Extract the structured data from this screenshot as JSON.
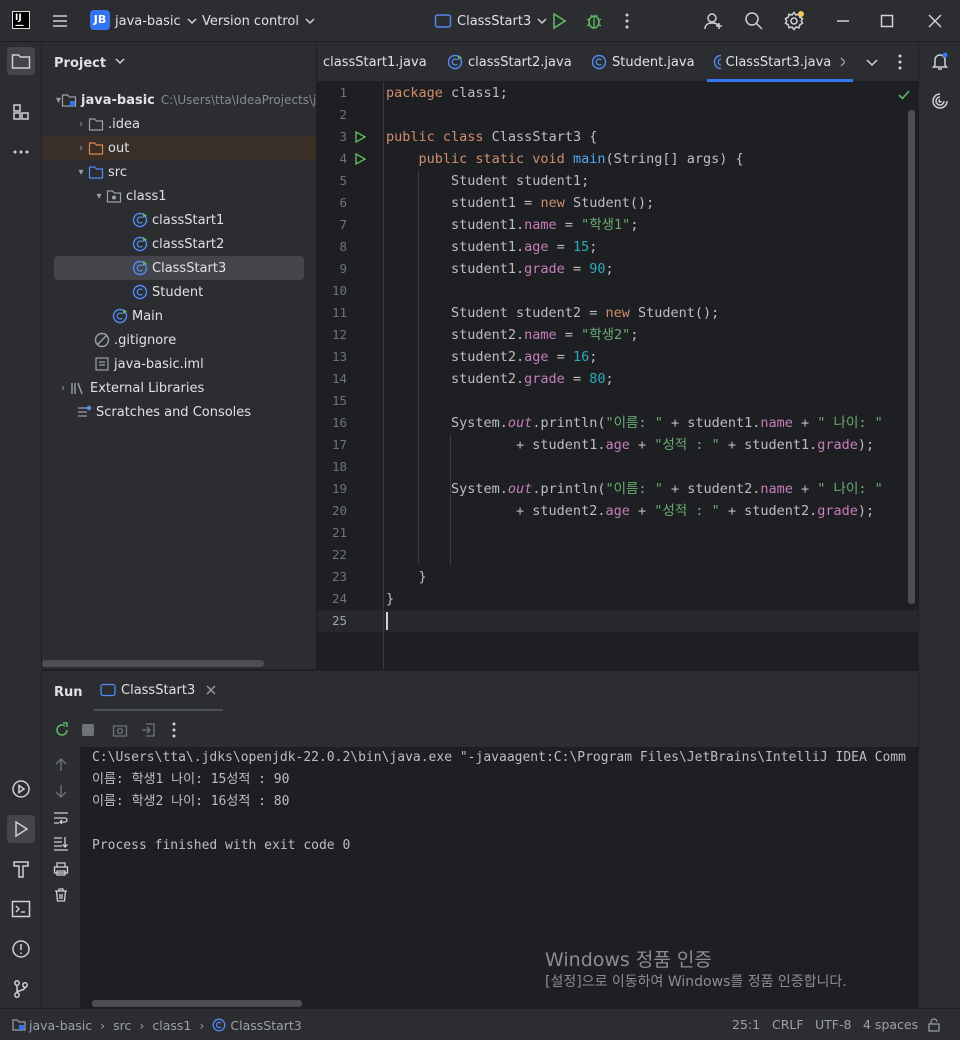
{
  "titlebar": {
    "project_badge": "JB",
    "project_name": "java-basic",
    "vcs_label": "Version control",
    "run_config": "ClassStart3"
  },
  "project_panel": {
    "title": "Project",
    "root_name": "java-basic",
    "root_path": "C:\\Users\\tta\\IdeaProjects\\ja",
    "items": [
      {
        "label": ".idea"
      },
      {
        "label": "out"
      },
      {
        "label": "src"
      },
      {
        "label": "class1"
      },
      {
        "label": "classStart1"
      },
      {
        "label": "classStart2"
      },
      {
        "label": "ClassStart3"
      },
      {
        "label": "Student"
      },
      {
        "label": "Main"
      },
      {
        "label": ".gitignore"
      },
      {
        "label": "java-basic.iml"
      },
      {
        "label": "External Libraries"
      },
      {
        "label": "Scratches and Consoles"
      }
    ]
  },
  "tabs": [
    {
      "label": "classStart1.java"
    },
    {
      "label": "classStart2.java"
    },
    {
      "label": "Student.java"
    },
    {
      "label": "ClassStart3.java"
    }
  ],
  "editor": {
    "line_numbers": [
      "1",
      "2",
      "3",
      "4",
      "5",
      "6",
      "7",
      "8",
      "9",
      "10",
      "11",
      "12",
      "13",
      "14",
      "15",
      "16",
      "17",
      "18",
      "19",
      "20",
      "21",
      "22",
      "23",
      "24",
      "25"
    ],
    "strings": {
      "s1": "\"학생1\"",
      "s2": "\"학생2\"",
      "name_lbl": "\"이름: \"",
      "age_lbl": "\" 나이: \"",
      "grade_lbl": "\"성적 : \""
    },
    "numbers": {
      "n15": "15",
      "n90": "90",
      "n16": "16",
      "n80": "80"
    }
  },
  "run_panel": {
    "title": "Run",
    "tab_label": "ClassStart3",
    "console_lines": [
      "C:\\Users\\tta\\.jdks\\openjdk-22.0.2\\bin\\java.exe \"-javaagent:C:\\Program Files\\JetBrains\\IntelliJ IDEA Comm",
      "이름: 학생1 나이: 15성적 : 90",
      "이름: 학생2 나이: 16성적 : 80",
      "",
      "Process finished with exit code 0"
    ]
  },
  "watermark": {
    "line1": "Windows 정품 인증",
    "line2": "[설정]으로 이동하여 Windows를 정품 인증합니다."
  },
  "statusbar": {
    "breadcrumb": [
      "java-basic",
      "src",
      "class1",
      "ClassStart3"
    ],
    "position": "25:1",
    "line_sep": "CRLF",
    "encoding": "UTF-8",
    "indent": "4 spaces"
  },
  "colors": {
    "accent": "#3574f0",
    "run_green": "#5fb865",
    "keyword": "#cf8e6d",
    "string": "#6aab73",
    "number": "#2aacb8",
    "field": "#c77dbb"
  }
}
